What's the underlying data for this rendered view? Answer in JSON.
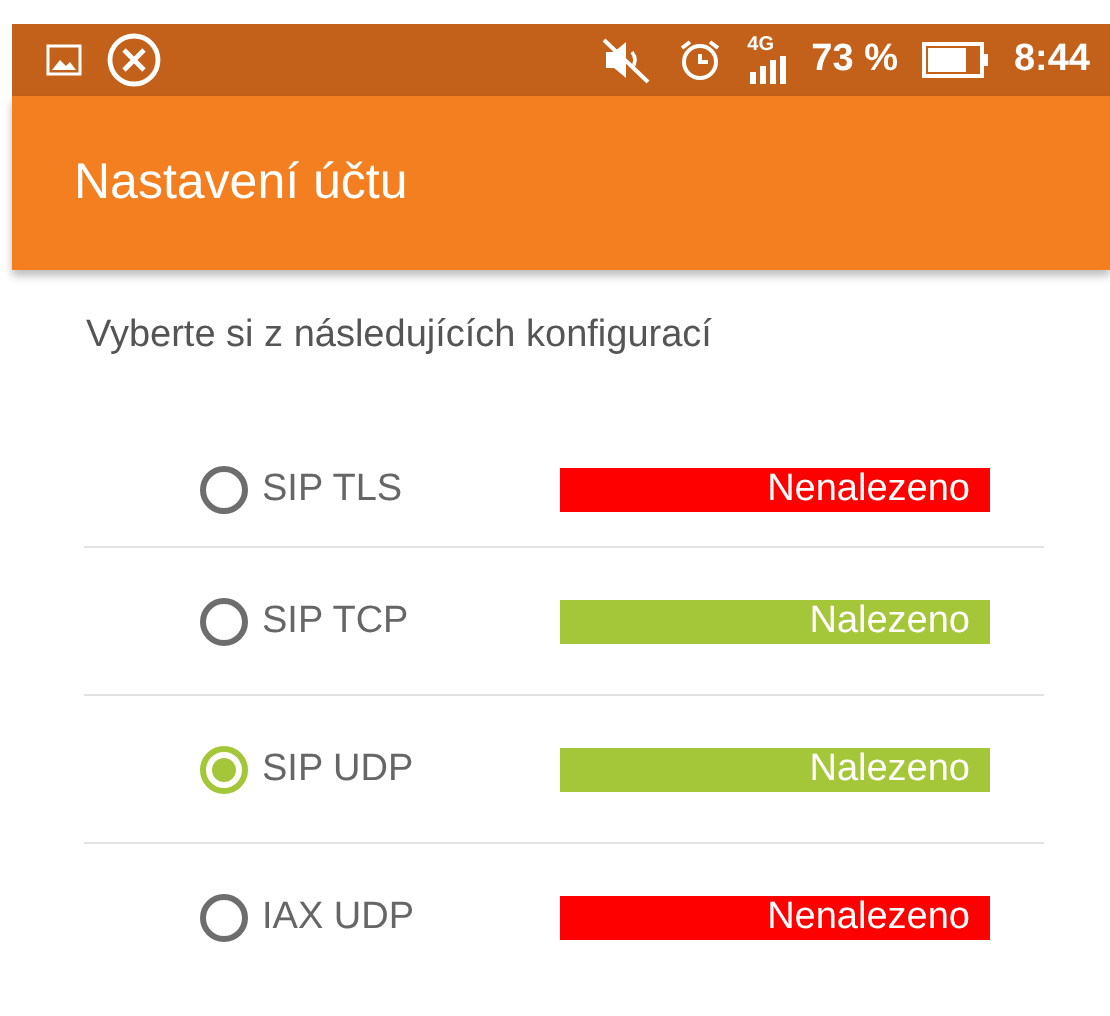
{
  "status_bar": {
    "network": "4G",
    "battery": "73 %",
    "time": "8:44"
  },
  "app_bar": {
    "title": "Nastavení účtu"
  },
  "subtitle": "Vyberte si z následujících konfigurací",
  "configs": [
    {
      "label": "SIP TLS",
      "selected": false,
      "status": "Nenalezeno",
      "color": "#ff0000"
    },
    {
      "label": "SIP TCP",
      "selected": false,
      "status": "Nalezeno",
      "color": "#a4c639"
    },
    {
      "label": "SIP UDP",
      "selected": true,
      "status": "Nalezeno",
      "color": "#a4c639"
    },
    {
      "label": "IAX UDP",
      "selected": false,
      "status": "Nenalezeno",
      "color": "#ff0000"
    }
  ]
}
